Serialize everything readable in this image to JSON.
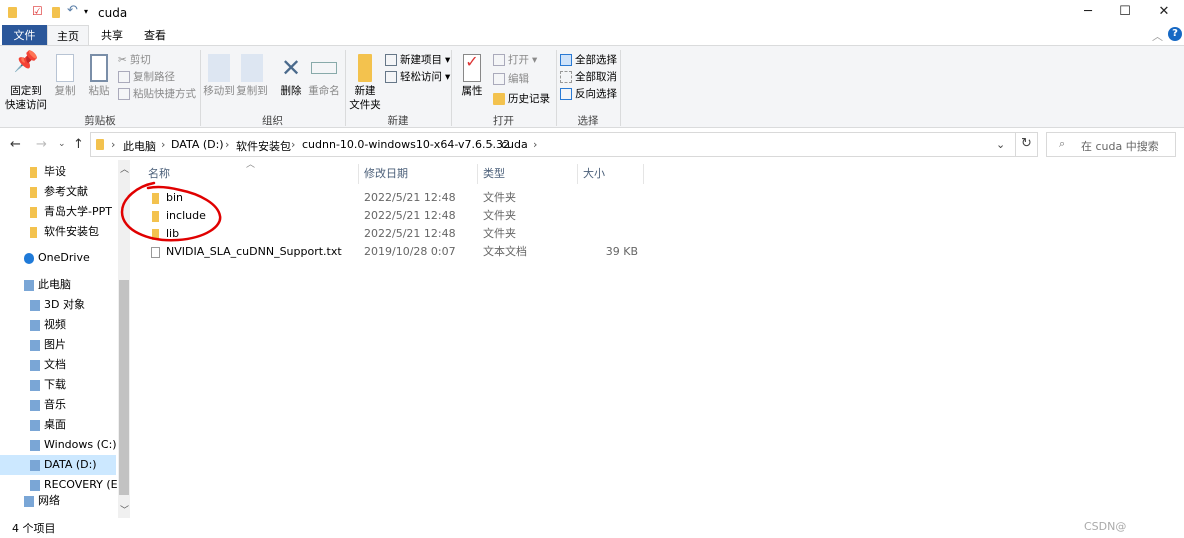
{
  "window": {
    "title": "cuda",
    "minimize_icon": "minimize-icon",
    "maximize_icon": "maximize-icon",
    "close_icon": "close-icon"
  },
  "tabs": [
    {
      "label": "文件"
    },
    {
      "label": "主页"
    },
    {
      "label": "共享"
    },
    {
      "label": "查看"
    }
  ],
  "ribbon": {
    "clipboard": {
      "label": "剪贴板",
      "pin": "固定到\n快速访问",
      "copy": "复制",
      "paste": "粘贴",
      "cut": "剪切",
      "copy_path": "复制路径",
      "paste_shortcut": "粘贴快捷方式"
    },
    "organize": {
      "label": "组织",
      "move_to": "移动到",
      "copy_to": "复制到",
      "delete": "删除",
      "rename": "重命名"
    },
    "new": {
      "label": "新建",
      "new_folder": "新建\n文件夹",
      "new_item": "新建项目",
      "easy_access": "轻松访问"
    },
    "open": {
      "label": "打开",
      "properties": "属性",
      "open": "打开",
      "edit": "编辑",
      "history": "历史记录"
    },
    "select": {
      "label": "选择",
      "select_all": "全部选择",
      "select_none": "全部取消",
      "invert": "反向选择"
    }
  },
  "address": {
    "crumbs": [
      "此电脑",
      "DATA (D:)",
      "软件安装包",
      "cudnn-10.0-windows10-x64-v7.6.5.32",
      "cuda"
    ]
  },
  "search": {
    "placeholder": "在 cuda 中搜索"
  },
  "nav": {
    "quick_access": [
      "毕设",
      "参考文献",
      "青岛大学-PPT",
      "软件安装包"
    ],
    "onedrive": "OneDrive",
    "this_pc": "此电脑",
    "pc_items": [
      "3D 对象",
      "视频",
      "图片",
      "文档",
      "下载",
      "音乐",
      "桌面",
      "Windows (C:)",
      "DATA (D:)",
      "RECOVERY (E:)"
    ],
    "network": "网络",
    "selected": "DATA (D:)"
  },
  "columns": {
    "name": "名称",
    "date": "修改日期",
    "type": "类型",
    "size": "大小"
  },
  "files": [
    {
      "name": "bin",
      "date": "2022/5/21 12:48",
      "type": "文件夹",
      "size": ""
    },
    {
      "name": "include",
      "date": "2022/5/21 12:48",
      "type": "文件夹",
      "size": ""
    },
    {
      "name": "lib",
      "date": "2022/5/21 12:48",
      "type": "文件夹",
      "size": ""
    },
    {
      "name": "NVIDIA_SLA_cuDNN_Support.txt",
      "date": "2019/10/28 0:07",
      "type": "文本文档",
      "size": "39 KB"
    }
  ],
  "status": {
    "count": "4 个项目"
  },
  "watermark": "CSDN@",
  "colors": {
    "file_tab": "#2b579a",
    "annotation": "#e00000",
    "selected": "#cce8ff",
    "folder": "#f3c24e"
  }
}
